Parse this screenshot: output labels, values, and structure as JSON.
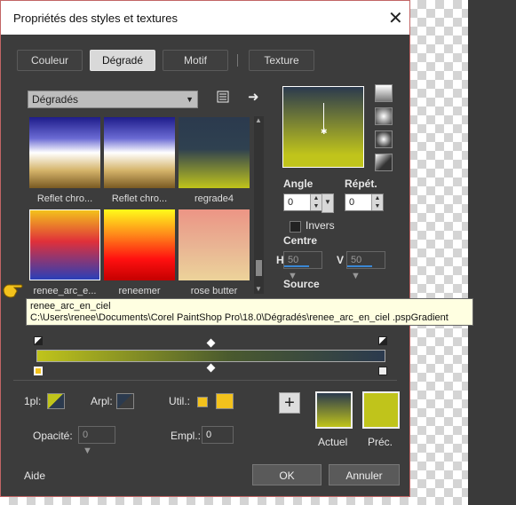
{
  "dialog": {
    "title": "Propriétés des styles et textures",
    "close": "✕"
  },
  "tabs": [
    {
      "label": "Couleur"
    },
    {
      "label": "Dégradé"
    },
    {
      "label": "Motif"
    },
    {
      "label": "Texture"
    }
  ],
  "gradients": {
    "category": "Dégradés",
    "items": [
      {
        "label": "Reflet chro..."
      },
      {
        "label": "Reflet chro..."
      },
      {
        "label": "regrade4"
      },
      {
        "label": "renee_arc_e..."
      },
      {
        "label": "reneemer"
      },
      {
        "label": "rose butter"
      }
    ]
  },
  "angle": {
    "label": "Angle",
    "value": "0"
  },
  "repeat": {
    "label": "Répét.",
    "value": "0"
  },
  "invert": {
    "label": "Invers"
  },
  "center": {
    "label": "Centre",
    "h_label": "H",
    "h_value": "50",
    "v_label": "V",
    "v_value": "50"
  },
  "source": {
    "label": "Source"
  },
  "tooltip": {
    "line1": "renee_arc_en_ciel",
    "line2": "C:\\Users\\renee\\Documents\\Corel PaintShop Pro\\18.0\\Dégradés\\renee_arc_en_ciel .pspGradient"
  },
  "editor": {
    "first_label": "1pl:",
    "second_label": "Arpl:",
    "util_label": "Util.:",
    "opacity_label": "Opacité:",
    "opacity_value": "0",
    "location_label": "Empl.:",
    "location_value": "0",
    "add_button": "+"
  },
  "colors": {
    "current_label": "Actuel",
    "previous_label": "Préc.",
    "accent": "#c0c41b",
    "dark": "#2b3a4e",
    "util_yellow": "#f3c21c"
  },
  "footer": {
    "help": "Aide",
    "ok": "OK",
    "cancel": "Annuler"
  }
}
